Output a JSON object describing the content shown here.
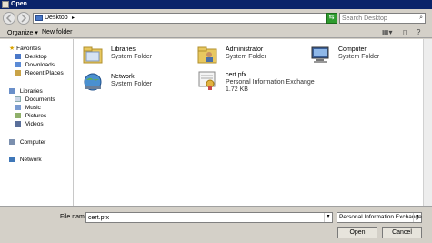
{
  "window": {
    "title": "Open"
  },
  "address": {
    "crumb": "Desktop",
    "crumb_arrow": "▸",
    "dropdown": "▾"
  },
  "search": {
    "placeholder": "Search Desktop"
  },
  "toolbar": {
    "organize": "Organize ▾",
    "new_folder": "New folder"
  },
  "nav": {
    "favorites": "Favorites",
    "desktop": "Desktop",
    "downloads": "Downloads",
    "recent": "Recent Places",
    "libraries": "Libraries",
    "documents": "Documents",
    "music": "Music",
    "pictures": "Pictures",
    "videos": "Videos",
    "computer": "Computer",
    "network": "Network"
  },
  "items": [
    {
      "name": "Libraries",
      "type": "System Folder",
      "size": ""
    },
    {
      "name": "Administrator",
      "type": "System Folder",
      "size": ""
    },
    {
      "name": "Computer",
      "type": "System Folder",
      "size": ""
    },
    {
      "name": "Network",
      "type": "System Folder",
      "size": ""
    },
    {
      "name": "cert.pfx",
      "type": "Personal Information Exchange",
      "size": "1.72 KB"
    }
  ],
  "bottom": {
    "file_name_label": "File name:",
    "file_name_value": "cert.pfx",
    "file_type": "Personal Information Exchange",
    "open_label": "Open",
    "cancel_label": "Cancel"
  },
  "colors": {
    "titlebar": "#0a246a",
    "chrome": "#d4d0c8",
    "folder": "#e8c860"
  }
}
